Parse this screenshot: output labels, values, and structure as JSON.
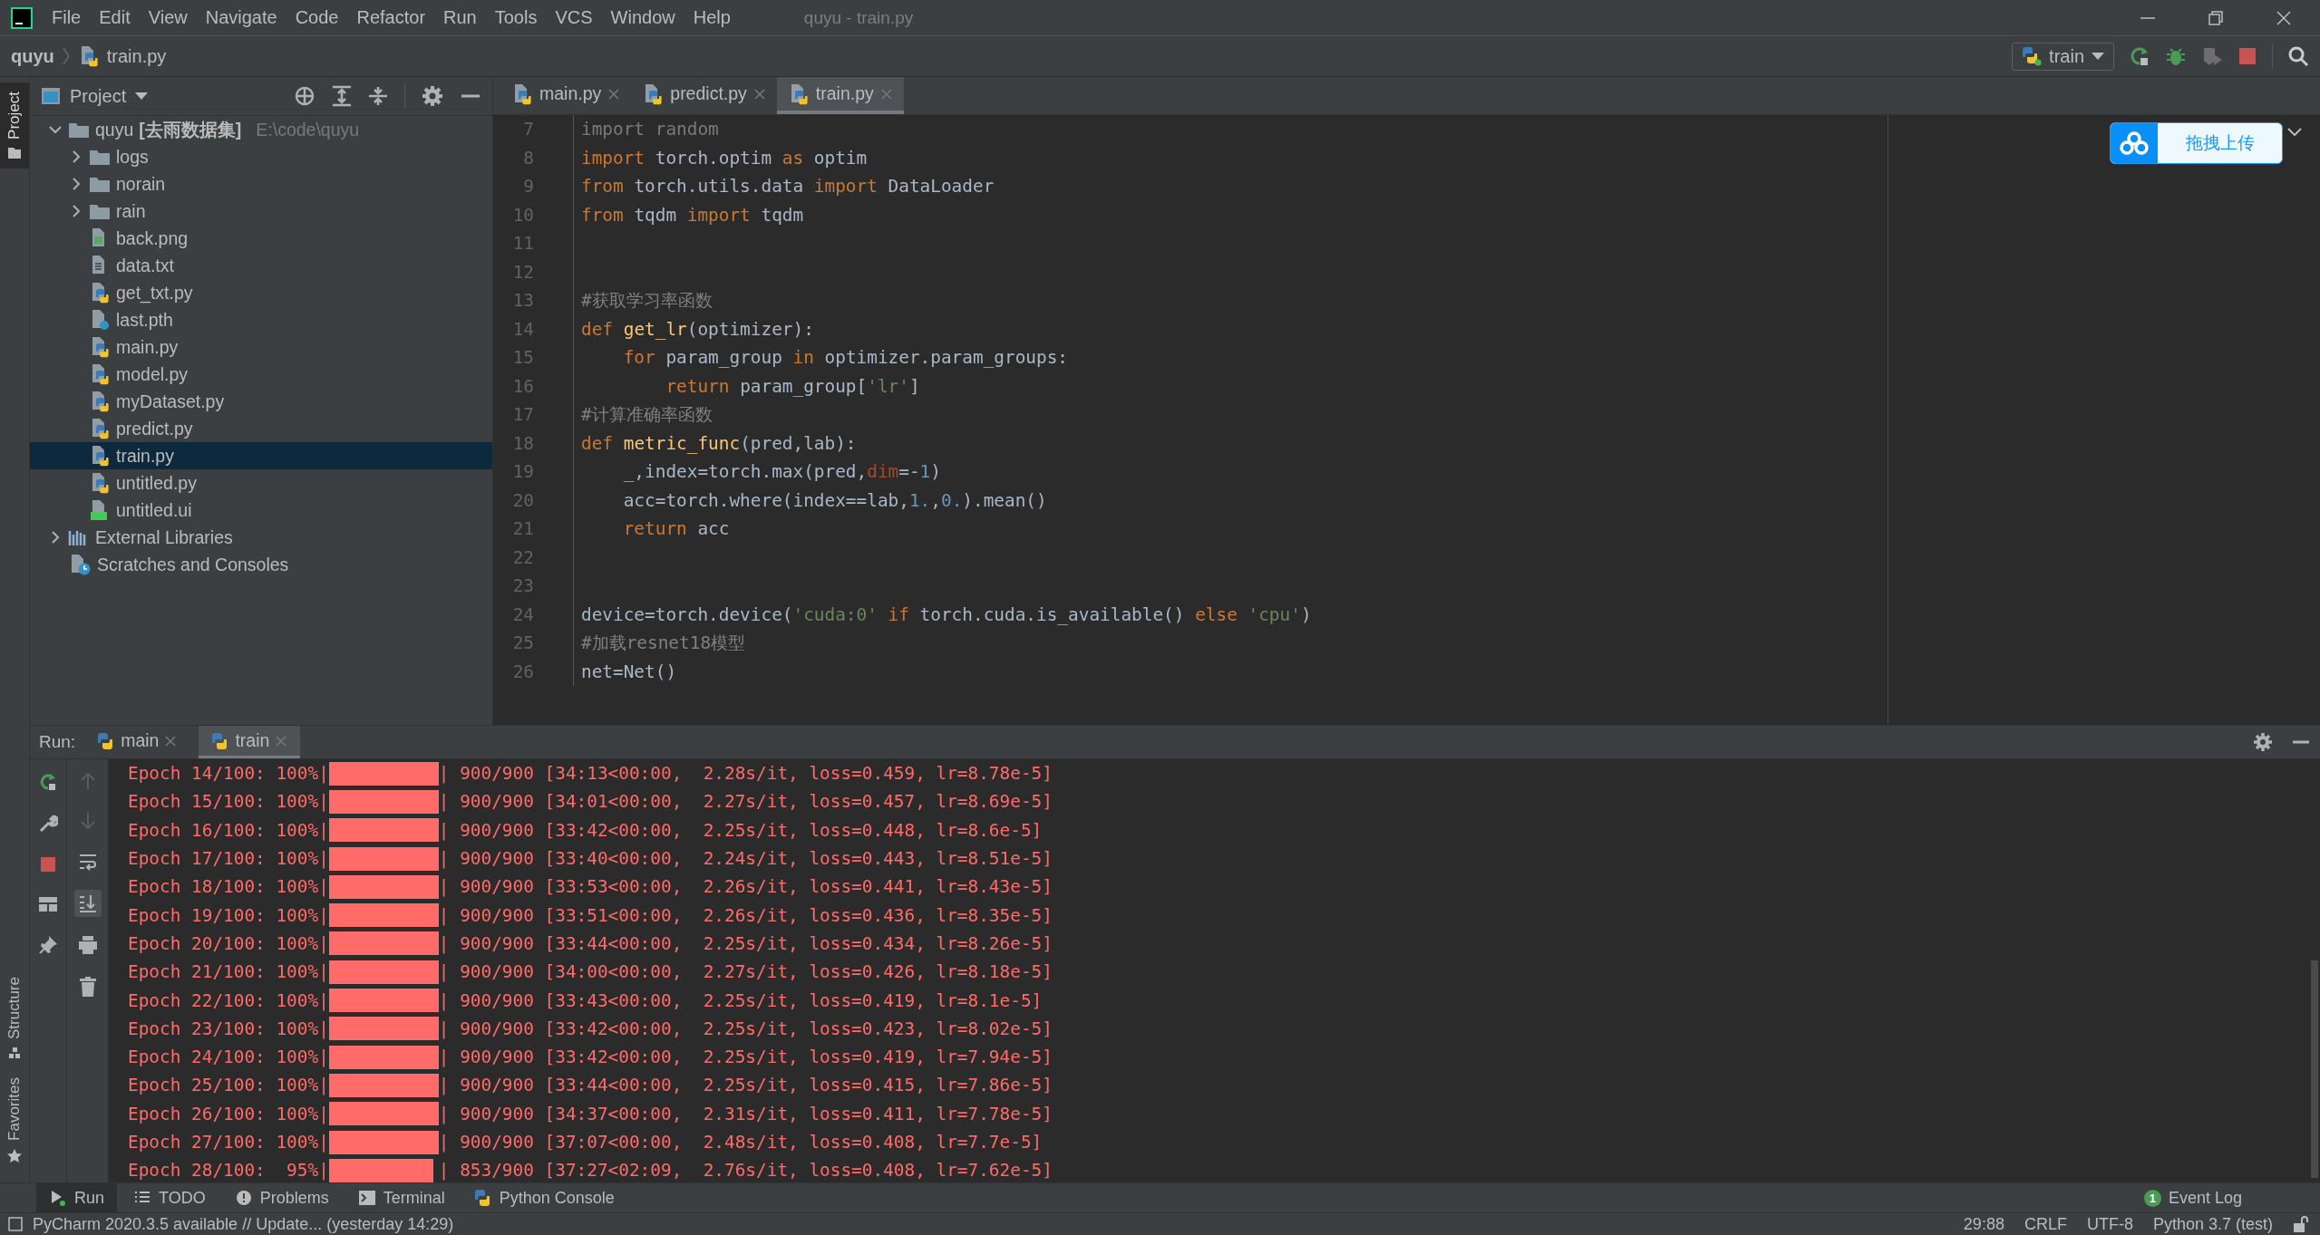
{
  "window": {
    "title": "quyu - train.py"
  },
  "menu": [
    "File",
    "Edit",
    "View",
    "Navigate",
    "Code",
    "Refactor",
    "Run",
    "Tools",
    "VCS",
    "Window",
    "Help"
  ],
  "breadcrumb": [
    "quyu",
    "train.py"
  ],
  "run_config": {
    "label": "train"
  },
  "side_tabs": [
    {
      "label": "Project",
      "kind": "project",
      "selected": true
    },
    {
      "label": "Structure",
      "kind": "structure",
      "selected": false
    },
    {
      "label": "Favorites",
      "kind": "favorites",
      "selected": false
    }
  ],
  "project": {
    "title": "Project",
    "tree": [
      {
        "name": "quyu",
        "tag": "[去雨数据集]",
        "path": "E:\\code\\quyu",
        "kind": "folder",
        "expanded": true,
        "selected": false,
        "children": [
          {
            "name": "logs",
            "kind": "folder",
            "expanded": false,
            "selected": false
          },
          {
            "name": "norain",
            "kind": "folder",
            "expanded": false,
            "selected": false
          },
          {
            "name": "rain",
            "kind": "folder",
            "expanded": false,
            "selected": false
          },
          {
            "name": "back.png",
            "kind": "image",
            "selected": false
          },
          {
            "name": "data.txt",
            "kind": "text",
            "selected": false
          },
          {
            "name": "get_txt.py",
            "kind": "python",
            "selected": false
          },
          {
            "name": "last.pth",
            "kind": "unknown",
            "selected": false
          },
          {
            "name": "main.py",
            "kind": "python",
            "selected": false
          },
          {
            "name": "model.py",
            "kind": "python",
            "selected": false
          },
          {
            "name": "myDataset.py",
            "kind": "python",
            "selected": false
          },
          {
            "name": "predict.py",
            "kind": "python",
            "selected": false
          },
          {
            "name": "train.py",
            "kind": "python",
            "selected": true
          },
          {
            "name": "untitled.py",
            "kind": "python",
            "selected": false
          },
          {
            "name": "untitled.ui",
            "kind": "qt",
            "selected": false
          }
        ]
      },
      {
        "name": "External Libraries",
        "kind": "library",
        "expanded": false,
        "selected": false
      },
      {
        "name": "Scratches and Consoles",
        "kind": "scratches",
        "selected": false
      }
    ]
  },
  "editor": {
    "tabs": [
      {
        "label": "main.py",
        "selected": false
      },
      {
        "label": "predict.py",
        "selected": false
      },
      {
        "label": "train.py",
        "selected": true
      }
    ],
    "lines": [
      {
        "number": "7",
        "tokens": [
          {
            "kind": "unused",
            "text": "import random"
          }
        ]
      },
      {
        "number": "8",
        "tokens": [
          {
            "kind": "kw",
            "text": "import"
          },
          {
            "kind": "plain",
            "text": " torch.optim "
          },
          {
            "kind": "kw",
            "text": "as"
          },
          {
            "kind": "plain",
            "text": " optim"
          }
        ]
      },
      {
        "number": "9",
        "tokens": [
          {
            "kind": "kw",
            "text": "from"
          },
          {
            "kind": "plain",
            "text": " torch.utils.data "
          },
          {
            "kind": "kw",
            "text": "import"
          },
          {
            "kind": "plain",
            "text": " DataLoader"
          }
        ]
      },
      {
        "number": "10",
        "tokens": [
          {
            "kind": "kw",
            "text": "from"
          },
          {
            "kind": "plain",
            "text": " tqdm "
          },
          {
            "kind": "kw",
            "text": "import"
          },
          {
            "kind": "plain",
            "text": " tqdm"
          }
        ]
      },
      {
        "number": "11"
      },
      {
        "number": "12"
      },
      {
        "number": "13",
        "tokens": [
          {
            "kind": "comment",
            "text": "#获取学习率函数"
          }
        ]
      },
      {
        "number": "14",
        "tokens": [
          {
            "kind": "kw",
            "text": "def "
          },
          {
            "kind": "fn",
            "text": "get_lr"
          },
          {
            "kind": "plain",
            "text": "(optimizer):"
          }
        ]
      },
      {
        "number": "15",
        "tokens": [
          {
            "kind": "kw",
            "text": "    for"
          },
          {
            "kind": "plain",
            "text": " param_group "
          },
          {
            "kind": "kw",
            "text": "in"
          },
          {
            "kind": "plain",
            "text": " optimizer.param_groups:"
          }
        ]
      },
      {
        "number": "16",
        "tokens": [
          {
            "kind": "kw",
            "text": "        return"
          },
          {
            "kind": "plain",
            "text": " param_group["
          },
          {
            "kind": "str",
            "text": "'lr'"
          },
          {
            "kind": "plain",
            "text": "]"
          }
        ]
      },
      {
        "number": "17",
        "tokens": [
          {
            "kind": "comment",
            "text": "#计算准确率函数"
          }
        ]
      },
      {
        "number": "18",
        "tokens": [
          {
            "kind": "kw",
            "text": "def "
          },
          {
            "kind": "fn",
            "text": "metric_func"
          },
          {
            "kind": "plain",
            "text": "(pred,lab):"
          }
        ]
      },
      {
        "number": "19",
        "tokens": [
          {
            "kind": "plain",
            "text": "    _,index=torch.max(pred,"
          },
          {
            "kind": "param",
            "text": "dim"
          },
          {
            "kind": "plain",
            "text": "=-"
          },
          {
            "kind": "num",
            "text": "1"
          },
          {
            "kind": "plain",
            "text": ")"
          }
        ]
      },
      {
        "number": "20",
        "tokens": [
          {
            "kind": "plain",
            "text": "    acc=torch.where(index==lab,"
          },
          {
            "kind": "num",
            "text": "1."
          },
          {
            "kind": "plain",
            "text": ","
          },
          {
            "kind": "num",
            "text": "0."
          },
          {
            "kind": "plain",
            "text": ").mean()"
          }
        ]
      },
      {
        "number": "21",
        "tokens": [
          {
            "kind": "kw",
            "text": "    return"
          },
          {
            "kind": "plain",
            "text": " acc"
          }
        ]
      },
      {
        "number": "22"
      },
      {
        "number": "23"
      },
      {
        "number": "24",
        "tokens": [
          {
            "kind": "plain",
            "text": "device=torch.device("
          },
          {
            "kind": "str",
            "text": "'cuda:0'"
          },
          {
            "kind": "kw",
            "text": " if"
          },
          {
            "kind": "plain",
            "text": " torch.cuda.is_available() "
          },
          {
            "kind": "kw",
            "text": "else"
          },
          {
            "kind": "str",
            "text": " 'cpu'"
          },
          {
            "kind": "plain",
            "text": ")"
          }
        ]
      },
      {
        "number": "25",
        "tokens": [
          {
            "kind": "comment",
            "text": "#加载resnet18模型"
          }
        ]
      },
      {
        "number": "26",
        "tokens": [
          {
            "kind": "plain",
            "text": "net=Net()"
          }
        ]
      }
    ]
  },
  "upload_widget": {
    "label": "拖拽上传"
  },
  "run_panel": {
    "title": "Run:",
    "tabs": [
      {
        "label": "main",
        "selected": false
      },
      {
        "label": "train",
        "selected": true
      }
    ],
    "lines": [
      {
        "prefix": "Epoch 14/100: 100%|",
        "level": 1,
        "stats": "| 900/900 [34:13<00:00,  2.28s/it, loss=0.459, lr=8.78e-5]"
      },
      {
        "prefix": "Epoch 15/100: 100%|",
        "level": 1,
        "stats": "| 900/900 [34:01<00:00,  2.27s/it, loss=0.457, lr=8.69e-5]"
      },
      {
        "prefix": "Epoch 16/100: 100%|",
        "level": 1,
        "stats": "| 900/900 [33:42<00:00,  2.25s/it, loss=0.448, lr=8.6e-5]"
      },
      {
        "prefix": "Epoch 17/100: 100%|",
        "level": 1,
        "stats": "| 900/900 [33:40<00:00,  2.24s/it, loss=0.443, lr=8.51e-5]"
      },
      {
        "prefix": "Epoch 18/100: 100%|",
        "level": 1,
        "stats": "| 900/900 [33:53<00:00,  2.26s/it, loss=0.441, lr=8.43e-5]"
      },
      {
        "prefix": "Epoch 19/100: 100%|",
        "level": 1,
        "stats": "| 900/900 [33:51<00:00,  2.26s/it, loss=0.436, lr=8.35e-5]"
      },
      {
        "prefix": "Epoch 20/100: 100%|",
        "level": 1,
        "stats": "| 900/900 [33:44<00:00,  2.25s/it, loss=0.434, lr=8.26e-5]"
      },
      {
        "prefix": "Epoch 21/100: 100%|",
        "level": 1,
        "stats": "| 900/900 [34:00<00:00,  2.27s/it, loss=0.426, lr=8.18e-5]"
      },
      {
        "prefix": "Epoch 22/100: 100%|",
        "level": 1,
        "stats": "| 900/900 [33:43<00:00,  2.25s/it, loss=0.419, lr=8.1e-5]"
      },
      {
        "prefix": "Epoch 23/100: 100%|",
        "level": 1,
        "stats": "| 900/900 [33:42<00:00,  2.25s/it, loss=0.423, lr=8.02e-5]"
      },
      {
        "prefix": "Epoch 24/100: 100%|",
        "level": 1,
        "stats": "| 900/900 [33:42<00:00,  2.25s/it, loss=0.419, lr=7.94e-5]"
      },
      {
        "prefix": "Epoch 25/100: 100%|",
        "level": 1,
        "stats": "| 900/900 [33:44<00:00,  2.25s/it, loss=0.415, lr=7.86e-5]"
      },
      {
        "prefix": "Epoch 26/100: 100%|",
        "level": 1,
        "stats": "| 900/900 [34:37<00:00,  2.31s/it, loss=0.411, lr=7.78e-5]"
      },
      {
        "prefix": "Epoch 27/100: 100%|",
        "level": 1,
        "stats": "| 900/900 [37:07<00:00,  2.48s/it, loss=0.408, lr=7.7e-5]"
      },
      {
        "prefix": "Epoch 28/100:  95%|",
        "level": 0.95,
        "stats": "| 853/900 [37:27<02:09,  2.76s/it, loss=0.408, lr=7.62e-5]"
      }
    ]
  },
  "tool_tabs": [
    {
      "label": "Run",
      "kind": "run",
      "selected": true
    },
    {
      "label": "TODO",
      "kind": "todo",
      "selected": false
    },
    {
      "label": "Problems",
      "kind": "problems",
      "selected": false
    },
    {
      "label": "Terminal",
      "kind": "terminal",
      "selected": false
    },
    {
      "label": "Python Console",
      "kind": "python",
      "selected": false
    }
  ],
  "event_log": {
    "label": "Event Log",
    "count": "1"
  },
  "status_bar": {
    "message": "PyCharm 2020.3.5 available // Update... (yesterday 14:29)",
    "items": [
      "29:88",
      "CRLF",
      "UTF-8",
      "Python 3.7 (test)"
    ]
  }
}
